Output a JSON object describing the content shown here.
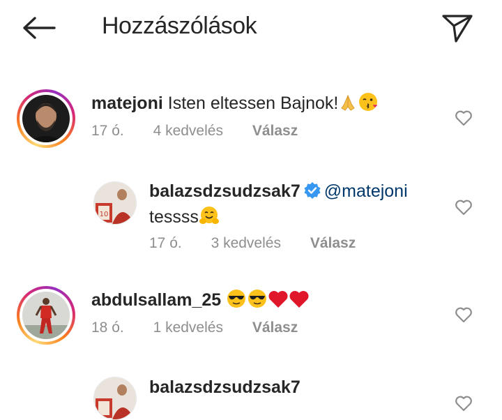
{
  "header": {
    "title": "Hozzászólások"
  },
  "comments": [
    {
      "username": "matejoni",
      "text": "Isten eltessen Bajnok!",
      "emojis": [
        "folded-hands",
        "kiss-face"
      ],
      "time": "17 ó.",
      "likes": "4 kedvelés",
      "reply_label": "Válasz"
    },
    {
      "username": "balazsdzsudzsak7",
      "mention": "@matejoni",
      "text": "tessss",
      "emojis": [
        "hugging-face"
      ],
      "time": "17 ó.",
      "likes": "3 kedvelés",
      "reply_label": "Válasz"
    },
    {
      "username": "abdulsallam_25",
      "text": "",
      "emojis": [
        "sunglasses-face",
        "sunglasses-face",
        "red-heart",
        "red-heart"
      ],
      "time": "18 ó.",
      "likes": "1 kedvelés",
      "reply_label": "Válasz"
    },
    {
      "username": "balazsdzsudzsak7"
    }
  ]
}
